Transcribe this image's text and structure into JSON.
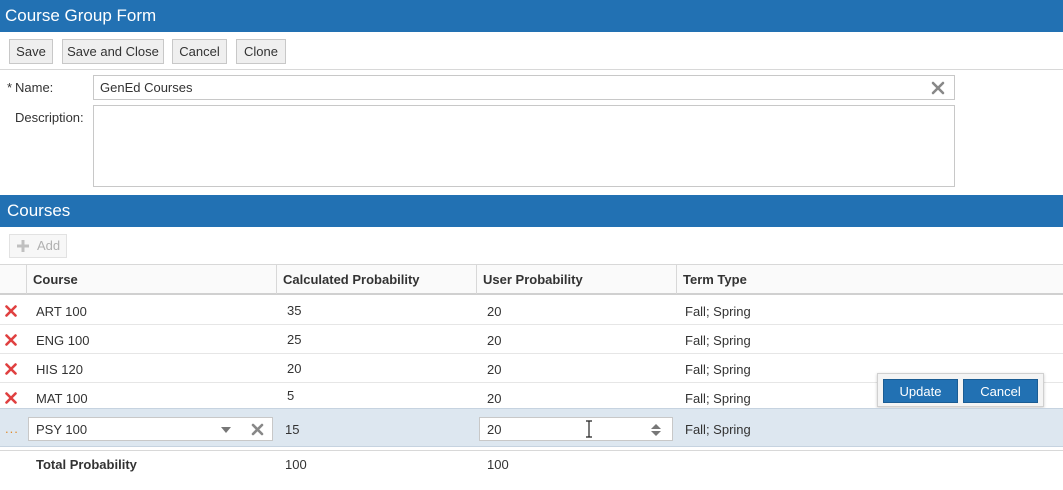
{
  "window": {
    "title": "Course Group Form"
  },
  "toolbar": {
    "save_label": "Save",
    "save_close_label": "Save and Close",
    "cancel_label": "Cancel",
    "clone_label": "Clone"
  },
  "form": {
    "name_label": "Name:",
    "required_marker": "*",
    "name_value": "GenEd Courses",
    "description_label": "Description:",
    "description_value": ""
  },
  "courses": {
    "section_title": "Courses",
    "add_label": "Add",
    "columns": [
      "Course",
      "Calculated Probability",
      "User Probability",
      "Term Type"
    ],
    "rows": [
      {
        "course": "ART 100",
        "calc": "35",
        "user": "20",
        "term": "Fall; Spring"
      },
      {
        "course": "ENG 100",
        "calc": "25",
        "user": "20",
        "term": "Fall; Spring"
      },
      {
        "course": "HIS 120",
        "calc": "20",
        "user": "20",
        "term": "Fall; Spring"
      },
      {
        "course": "MAT 100",
        "calc": "5",
        "user": "20",
        "term": "Fall; Spring"
      }
    ],
    "edit_row": {
      "row_marker": "...",
      "course": "PSY 100",
      "calc": "15",
      "user": "20",
      "term": "Fall; Spring"
    },
    "popup": {
      "update_label": "Update",
      "cancel_label": "Cancel"
    },
    "total": {
      "label": "Total Probability",
      "calc": "100",
      "user": "100"
    }
  },
  "colors": {
    "header_blue": "#2271b3",
    "delete_red": "#e04040",
    "edit_row_bg": "#dde7f0"
  }
}
